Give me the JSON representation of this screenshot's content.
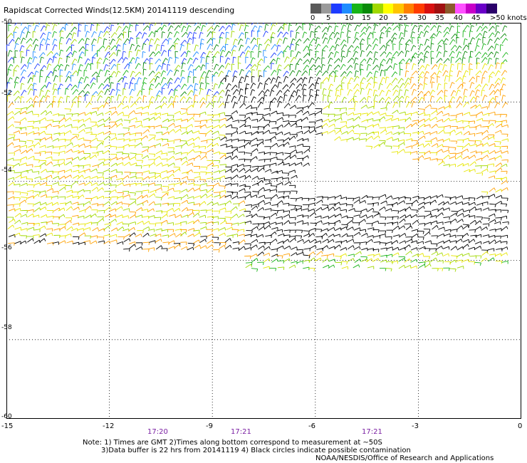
{
  "title": "Rapidscat Corrected Winds(12.5KM) 20141119 descending",
  "scale": {
    "colors": [
      "#5a5a5a",
      "#9a9a9a",
      "#1e3cff",
      "#1f8cff",
      "#18b418",
      "#0a8a0a",
      "#a0d800",
      "#ffff00",
      "#ffc400",
      "#ff7f00",
      "#ff3c00",
      "#d81010",
      "#a01010",
      "#8b5a2b",
      "#ff50ff",
      "#c800c8",
      "#6a00c8",
      "#2a006a"
    ],
    "labels": [
      "0",
      "5",
      "10",
      "15",
      "20",
      "25",
      "30",
      "35",
      "40",
      "45",
      ">50 knots"
    ]
  },
  "axes": {
    "x_ticks": [
      "-15",
      "-12",
      "-9",
      "-6",
      "-3",
      "0"
    ],
    "y_ticks": [
      "-50",
      "-52",
      "-54",
      "-56",
      "-58",
      "-60"
    ],
    "x_range": [
      -15,
      0
    ],
    "y_range": [
      -50,
      -60
    ]
  },
  "times": [
    "17:20",
    "17:21",
    "17:21"
  ],
  "notes": [
    "Note: 1) Times are GMT 2)Times along bottom correspond to measurement at ~50S",
    "3)Data buffer is 22 hrs from 20141119 4) Black circles indicate possible contamination",
    "NOAA/NESDIS/Office of Research and Applications"
  ]
}
